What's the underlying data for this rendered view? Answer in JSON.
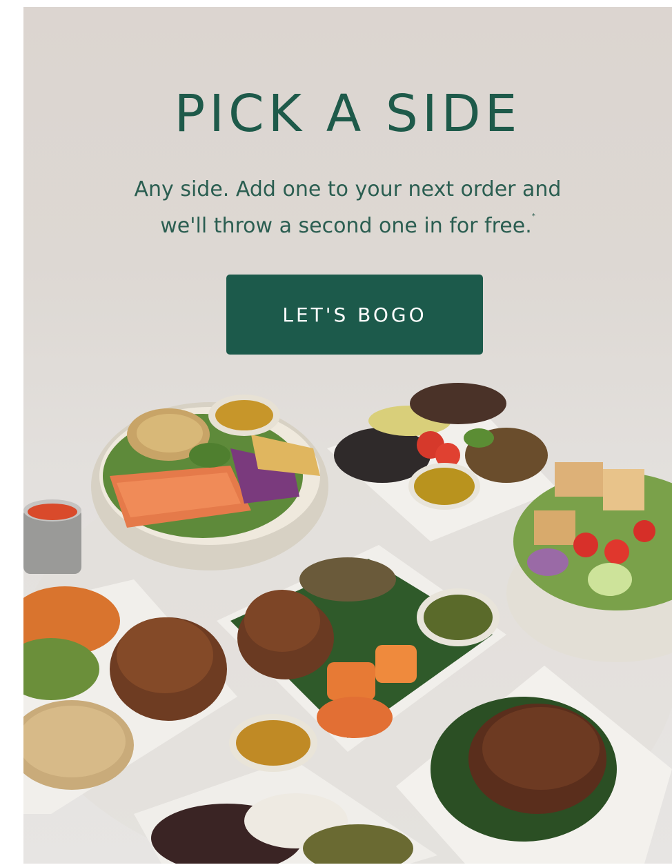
{
  "promo": {
    "headline": "PICK A SIDE",
    "subtext_line1": "Any side. Add one to your next order and",
    "subtext_line2": "we'll throw a second one in for free.",
    "footnote_mark": "*",
    "cta_label": "LET'S BOGO"
  },
  "colors": {
    "brand_green": "#1c5a4b",
    "text_green": "#2b5e51",
    "background": "#ddd8d3"
  },
  "image": {
    "subject": "food-bowls-photo"
  }
}
